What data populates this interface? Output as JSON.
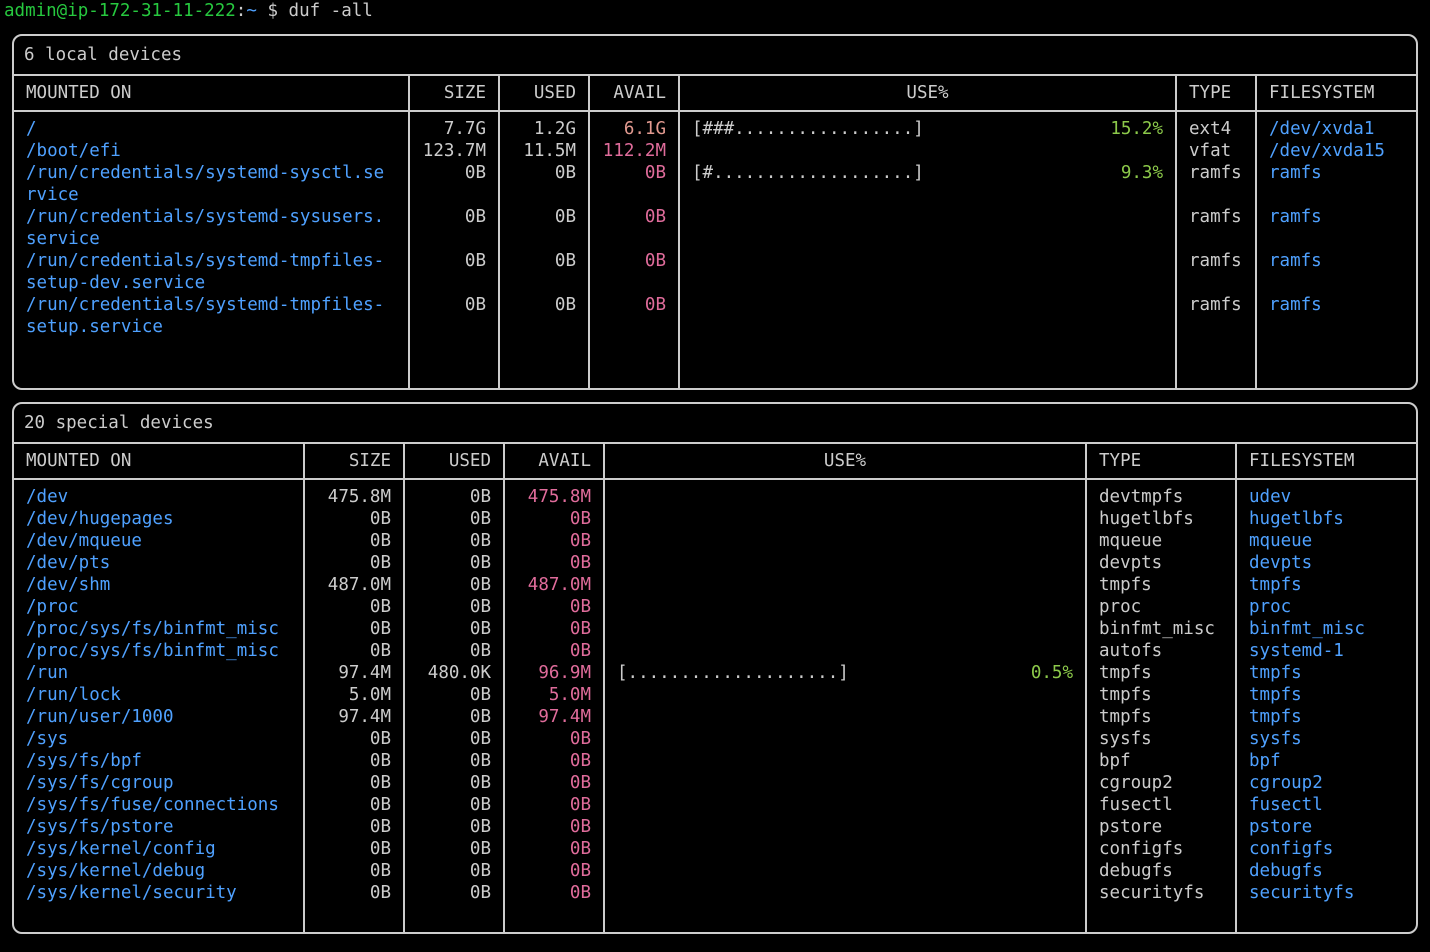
{
  "prompt": {
    "user": "admin@ip-172-31-11-222",
    "path": "~",
    "symbol": "$",
    "command": "duf -all"
  },
  "tables": [
    {
      "title": "6 local devices",
      "headers": [
        "MOUNTED ON",
        "SIZE",
        "USED",
        "AVAIL",
        "USE%",
        "TYPE",
        "FILESYSTEM"
      ],
      "col_widths": [
        "395px",
        "90px",
        "90px",
        "90px",
        "auto",
        "80px",
        "160px"
      ],
      "rows": [
        {
          "mount": "/",
          "size": "7.7G",
          "used": "1.2G",
          "avail": "6.1G",
          "avail_class": "avail-salmon",
          "bar": "[###.................]",
          "pct": "15.2%",
          "type": "ext4",
          "fs": "/dev/xvda1"
        },
        {
          "mount": "/boot/efi",
          "size": "123.7M",
          "used": "11.5M",
          "avail": "112.2M",
          "avail_class": "avail-mag",
          "bar": "[#...................]",
          "pct": "9.3%",
          "type": "vfat",
          "fs": "/dev/xvda15"
        },
        {
          "mount": "/run/credentials/systemd-sysctl.se\nrvice",
          "size": "0B",
          "used": "0B",
          "avail": "0B",
          "avail_class": "avail-mag",
          "bar": "",
          "pct": "",
          "type": "ramfs",
          "fs": "ramfs"
        },
        {
          "mount": "/run/credentials/systemd-sysusers.\nservice",
          "size": "0B",
          "used": "0B",
          "avail": "0B",
          "avail_class": "avail-mag",
          "bar": "",
          "pct": "",
          "type": "ramfs",
          "fs": "ramfs"
        },
        {
          "mount": "/run/credentials/systemd-tmpfiles-\nsetup-dev.service",
          "size": "0B",
          "used": "0B",
          "avail": "0B",
          "avail_class": "avail-mag",
          "bar": "",
          "pct": "",
          "type": "ramfs",
          "fs": "ramfs"
        },
        {
          "mount": "/run/credentials/systemd-tmpfiles-\nsetup.service",
          "size": "0B",
          "used": "0B",
          "avail": "0B",
          "avail_class": "avail-mag",
          "bar": "",
          "pct": "",
          "type": "ramfs",
          "fs": "ramfs"
        }
      ]
    },
    {
      "title": "20 special devices",
      "headers": [
        "MOUNTED ON",
        "SIZE",
        "USED",
        "AVAIL",
        "USE%",
        "TYPE",
        "FILESYSTEM"
      ],
      "col_widths": [
        "290px",
        "100px",
        "100px",
        "100px",
        "auto",
        "150px",
        "180px"
      ],
      "rows": [
        {
          "mount": "/dev",
          "size": "475.8M",
          "used": "0B",
          "avail": "475.8M",
          "avail_class": "avail-mag",
          "bar": "",
          "pct": "",
          "type": "devtmpfs",
          "fs": "udev"
        },
        {
          "mount": "/dev/hugepages",
          "size": "0B",
          "used": "0B",
          "avail": "0B",
          "avail_class": "avail-mag",
          "bar": "",
          "pct": "",
          "type": "hugetlbfs",
          "fs": "hugetlbfs"
        },
        {
          "mount": "/dev/mqueue",
          "size": "0B",
          "used": "0B",
          "avail": "0B",
          "avail_class": "avail-mag",
          "bar": "",
          "pct": "",
          "type": "mqueue",
          "fs": "mqueue"
        },
        {
          "mount": "/dev/pts",
          "size": "0B",
          "used": "0B",
          "avail": "0B",
          "avail_class": "avail-mag",
          "bar": "",
          "pct": "",
          "type": "devpts",
          "fs": "devpts"
        },
        {
          "mount": "/dev/shm",
          "size": "487.0M",
          "used": "0B",
          "avail": "487.0M",
          "avail_class": "avail-mag",
          "bar": "",
          "pct": "",
          "type": "tmpfs",
          "fs": "tmpfs"
        },
        {
          "mount": "/proc",
          "size": "0B",
          "used": "0B",
          "avail": "0B",
          "avail_class": "avail-mag",
          "bar": "",
          "pct": "",
          "type": "proc",
          "fs": "proc"
        },
        {
          "mount": "/proc/sys/fs/binfmt_misc",
          "size": "0B",
          "used": "0B",
          "avail": "0B",
          "avail_class": "avail-mag",
          "bar": "",
          "pct": "",
          "type": "binfmt_misc",
          "fs": "binfmt_misc"
        },
        {
          "mount": "/proc/sys/fs/binfmt_misc",
          "size": "0B",
          "used": "0B",
          "avail": "0B",
          "avail_class": "avail-mag",
          "bar": "",
          "pct": "",
          "type": "autofs",
          "fs": "systemd-1"
        },
        {
          "mount": "/run",
          "size": "97.4M",
          "used": "480.0K",
          "avail": "96.9M",
          "avail_class": "avail-mag",
          "bar": "[....................]",
          "pct": "0.5%",
          "type": "tmpfs",
          "fs": "tmpfs"
        },
        {
          "mount": "/run/lock",
          "size": "5.0M",
          "used": "0B",
          "avail": "5.0M",
          "avail_class": "avail-mag",
          "bar": "",
          "pct": "",
          "type": "tmpfs",
          "fs": "tmpfs"
        },
        {
          "mount": "/run/user/1000",
          "size": "97.4M",
          "used": "0B",
          "avail": "97.4M",
          "avail_class": "avail-mag",
          "bar": "",
          "pct": "",
          "type": "tmpfs",
          "fs": "tmpfs"
        },
        {
          "mount": "/sys",
          "size": "0B",
          "used": "0B",
          "avail": "0B",
          "avail_class": "avail-mag",
          "bar": "",
          "pct": "",
          "type": "sysfs",
          "fs": "sysfs"
        },
        {
          "mount": "/sys/fs/bpf",
          "size": "0B",
          "used": "0B",
          "avail": "0B",
          "avail_class": "avail-mag",
          "bar": "",
          "pct": "",
          "type": "bpf",
          "fs": "bpf"
        },
        {
          "mount": "/sys/fs/cgroup",
          "size": "0B",
          "used": "0B",
          "avail": "0B",
          "avail_class": "avail-mag",
          "bar": "",
          "pct": "",
          "type": "cgroup2",
          "fs": "cgroup2"
        },
        {
          "mount": "/sys/fs/fuse/connections",
          "size": "0B",
          "used": "0B",
          "avail": "0B",
          "avail_class": "avail-mag",
          "bar": "",
          "pct": "",
          "type": "fusectl",
          "fs": "fusectl"
        },
        {
          "mount": "/sys/fs/pstore",
          "size": "0B",
          "used": "0B",
          "avail": "0B",
          "avail_class": "avail-mag",
          "bar": "",
          "pct": "",
          "type": "pstore",
          "fs": "pstore"
        },
        {
          "mount": "/sys/kernel/config",
          "size": "0B",
          "used": "0B",
          "avail": "0B",
          "avail_class": "avail-mag",
          "bar": "",
          "pct": "",
          "type": "configfs",
          "fs": "configfs"
        },
        {
          "mount": "/sys/kernel/debug",
          "size": "0B",
          "used": "0B",
          "avail": "0B",
          "avail_class": "avail-mag",
          "bar": "",
          "pct": "",
          "type": "debugfs",
          "fs": "debugfs"
        },
        {
          "mount": "/sys/kernel/security",
          "size": "0B",
          "used": "0B",
          "avail": "0B",
          "avail_class": "avail-mag",
          "bar": "",
          "pct": "",
          "type": "securityfs",
          "fs": "securityfs"
        }
      ]
    }
  ]
}
